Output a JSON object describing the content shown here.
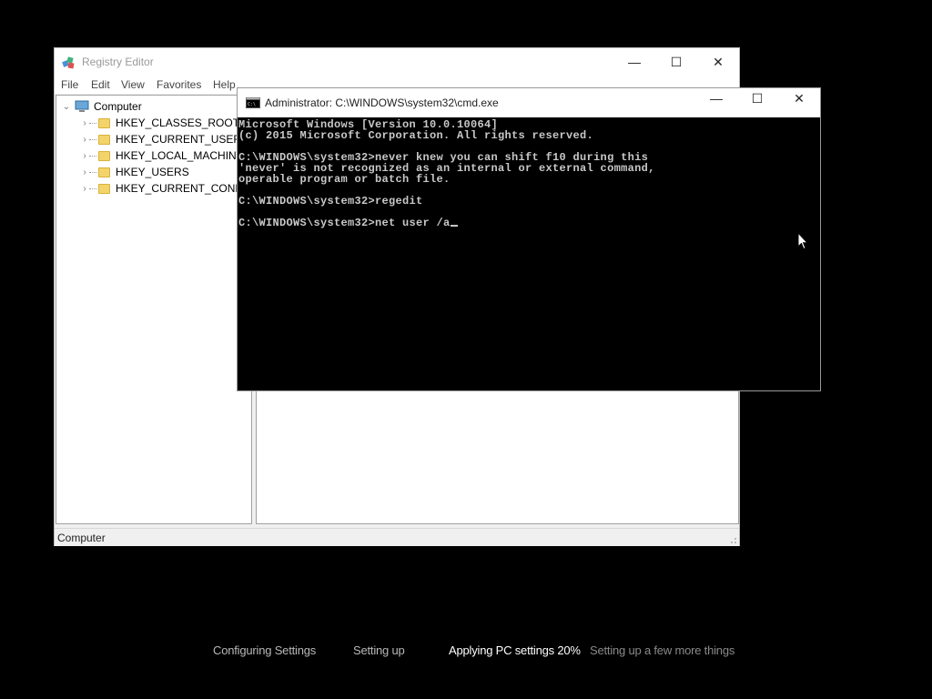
{
  "regedit": {
    "title": "Registry Editor",
    "menu": [
      "File",
      "Edit",
      "View",
      "Favorites",
      "Help"
    ],
    "tree": {
      "root": "Computer",
      "keys": [
        "HKEY_CLASSES_ROOT",
        "HKEY_CURRENT_USER",
        "HKEY_LOCAL_MACHINE",
        "HKEY_USERS",
        "HKEY_CURRENT_CONFIG"
      ]
    },
    "status": "Computer",
    "window_buttons": {
      "minimize": "—",
      "maximize": "☐",
      "close": "✕"
    }
  },
  "cmd": {
    "title": "Administrator: C:\\WINDOWS\\system32\\cmd.exe",
    "window_buttons": {
      "minimize": "—",
      "maximize": "☐",
      "close": "✕"
    },
    "lines": [
      "Microsoft Windows [Version 10.0.10064]",
      "(c) 2015 Microsoft Corporation. All rights reserved.",
      "",
      "C:\\WINDOWS\\system32>never knew you can shift f10 during this",
      "'never' is not recognized as an internal or external command,",
      "operable program or batch file.",
      "",
      "C:\\WINDOWS\\system32>regedit",
      "",
      "C:\\WINDOWS\\system32>net user /a"
    ]
  },
  "setup": {
    "steps": [
      {
        "label": "Configuring Settings",
        "color": "#b8b8b8"
      },
      {
        "label": "Setting up",
        "color": "#b8b8b8"
      },
      {
        "label": "Applying PC settings 20%",
        "color": "#ffffff"
      },
      {
        "label": "Setting up a few more things",
        "color": "#8a8a8a"
      }
    ]
  },
  "colors": {
    "background": "#000000",
    "console_text": "#c8c8c8",
    "folder": "#f3d46b"
  }
}
